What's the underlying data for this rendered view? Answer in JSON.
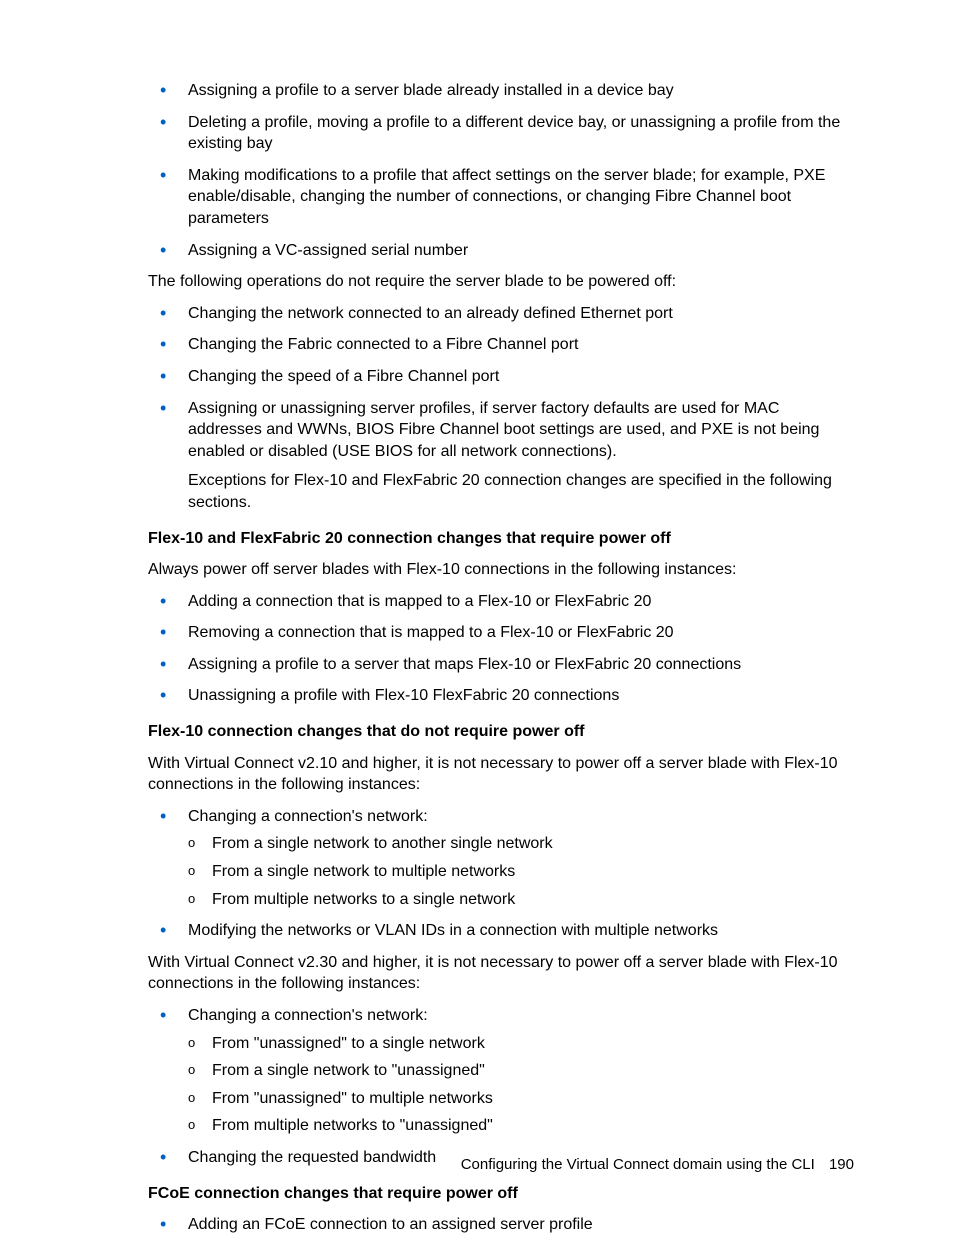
{
  "top_bullets": [
    "Assigning a profile to a server blade already installed in a device bay",
    "Deleting a profile, moving a profile to a different device bay, or unassigning a profile from the existing bay",
    "Making modifications to a profile that affect settings on the server blade; for example, PXE enable/disable, changing the number of connections, or changing Fibre Channel boot parameters",
    "Assigning a VC-assigned serial number"
  ],
  "para1": "The following operations do not require the server blade to be powered off:",
  "mid_bullets": [
    "Changing the network connected to an already defined Ethernet port",
    "Changing the Fabric connected to a Fibre Channel port",
    "Changing the speed of a Fibre Channel port"
  ],
  "mid_last_bullet_main": "Assigning or unassigning server profiles, if server factory defaults are used for MAC addresses and WWNs, BIOS Fibre Channel boot settings are used, and PXE is not being enabled or disabled (USE BIOS for all network connections).",
  "mid_last_bullet_note": "Exceptions for Flex-10 and FlexFabric 20 connection changes are specified in the following sections.",
  "heading1": "Flex-10 and FlexFabric 20 connection changes that require power off",
  "para2": "Always power off server blades with Flex-10 connections in the following instances:",
  "section1_bullets": [
    "Adding a connection that is mapped to a Flex-10 or FlexFabric 20",
    "Removing a connection that is mapped to a Flex-10 or FlexFabric 20",
    "Assigning a profile to a server that maps Flex-10 or FlexFabric 20 connections",
    "Unassigning a profile with Flex-10 FlexFabric 20 connections"
  ],
  "heading2": "Flex-10 connection changes that do not require power off",
  "para3": "With Virtual Connect v2.10 and higher, it is not necessary to power off a server blade with Flex-10 connections in the following instances:",
  "section2_bullet1_main": "Changing a connection's network:",
  "section2_bullet1_subs": [
    "From a single network to another single network",
    "From a single network to multiple networks",
    "From multiple networks to a single network"
  ],
  "section2_bullet2": "Modifying the networks or VLAN IDs in a connection with multiple networks",
  "para4": "With Virtual Connect v2.30 and higher, it is not necessary to power off a server blade with Flex-10 connections in the following instances:",
  "section3_bullet1_main": "Changing a connection's network:",
  "section3_bullet1_subs": [
    "From \"unassigned\" to a single network",
    "From a single network to \"unassigned\"",
    "From \"unassigned\" to multiple networks",
    "From multiple networks to \"unassigned\""
  ],
  "section3_bullet2": "Changing the requested bandwidth",
  "heading3": "FCoE connection changes that require power off",
  "section4_bullets": [
    "Adding an FCoE connection to an assigned server profile"
  ],
  "footer_text": "Configuring the Virtual Connect domain using the CLI",
  "footer_page": "190"
}
